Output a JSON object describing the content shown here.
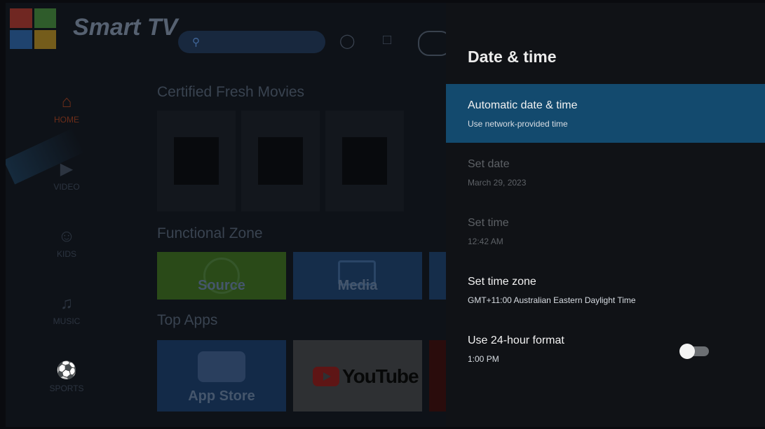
{
  "home": {
    "brand": "Smart TV",
    "sidebar": [
      {
        "label": "HOME",
        "icon": "home-icon",
        "glyph": "⌂"
      },
      {
        "label": "VIDEO",
        "icon": "video-icon",
        "glyph": "▶"
      },
      {
        "label": "KIDS",
        "icon": "kids-icon",
        "glyph": "☺"
      },
      {
        "label": "MUSIC",
        "icon": "music-icon",
        "glyph": "♫"
      },
      {
        "label": "SPORTS",
        "icon": "sports-icon",
        "glyph": "⚽"
      }
    ],
    "sections": {
      "movies": "Certified Fresh Movies",
      "functional": "Functional Zone",
      "apps": "Top Apps"
    },
    "functional_tiles": [
      "Source",
      "Media"
    ],
    "app_tiles": [
      "App Store",
      "YouTube"
    ]
  },
  "settings": {
    "title": "Date & time",
    "rows": [
      {
        "label": "Automatic date & time",
        "sub": "Use network-provided time"
      },
      {
        "label": "Set date",
        "sub": "March 29, 2023"
      },
      {
        "label": "Set time",
        "sub": "12:42 AM"
      },
      {
        "label": "Set time zone",
        "sub": "GMT+11:00 Australian Eastern Daylight Time"
      },
      {
        "label": "Use 24-hour format",
        "sub": "1:00 PM"
      }
    ],
    "toggle_24h_on": false
  },
  "colors": {
    "focus": "#134a6e",
    "panel_bg": "#101216",
    "accent_home": "#6b2d19"
  }
}
